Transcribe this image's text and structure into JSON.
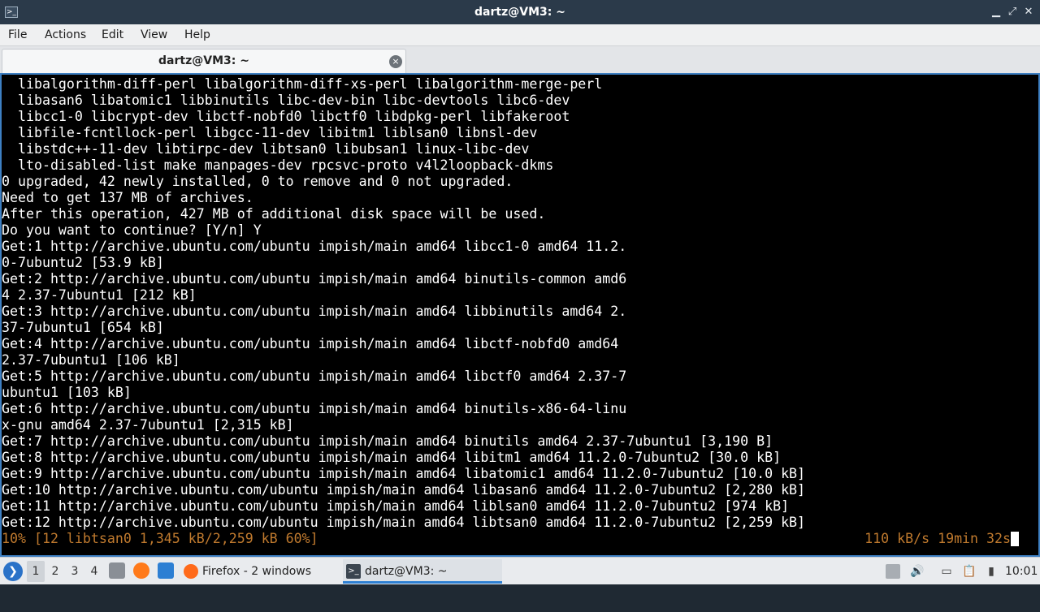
{
  "window": {
    "title": "dartz@VM3: ~",
    "min_glyph": "▁",
    "max_glyph": "⤢",
    "close_glyph": "✕",
    "app_icon_glyph": ">_"
  },
  "menu": {
    "file": "File",
    "actions": "Actions",
    "edit": "Edit",
    "view": "View",
    "help": "Help"
  },
  "tab": {
    "label": "dartz@VM3: ~",
    "close_glyph": "×"
  },
  "terminal": {
    "lines": [
      "  libalgorithm-diff-perl libalgorithm-diff-xs-perl libalgorithm-merge-perl",
      "  libasan6 libatomic1 libbinutils libc-dev-bin libc-devtools libc6-dev",
      "  libcc1-0 libcrypt-dev libctf-nobfd0 libctf0 libdpkg-perl libfakeroot",
      "  libfile-fcntllock-perl libgcc-11-dev libitm1 liblsan0 libnsl-dev",
      "  libstdc++-11-dev libtirpc-dev libtsan0 libubsan1 linux-libc-dev",
      "  lto-disabled-list make manpages-dev rpcsvc-proto v4l2loopback-dkms",
      "0 upgraded, 42 newly installed, 0 to remove and 0 not upgraded.",
      "Need to get 137 MB of archives.",
      "After this operation, 427 MB of additional disk space will be used.",
      "Do you want to continue? [Y/n] Y",
      "Get:1 http://archive.ubuntu.com/ubuntu impish/main amd64 libcc1-0 amd64 11.2.",
      "0-7ubuntu2 [53.9 kB]",
      "Get:2 http://archive.ubuntu.com/ubuntu impish/main amd64 binutils-common amd6",
      "4 2.37-7ubuntu1 [212 kB]",
      "Get:3 http://archive.ubuntu.com/ubuntu impish/main amd64 libbinutils amd64 2.",
      "37-7ubuntu1 [654 kB]",
      "Get:4 http://archive.ubuntu.com/ubuntu impish/main amd64 libctf-nobfd0 amd64",
      "2.37-7ubuntu1 [106 kB]",
      "Get:5 http://archive.ubuntu.com/ubuntu impish/main amd64 libctf0 amd64 2.37-7",
      "ubuntu1 [103 kB]",
      "Get:6 http://archive.ubuntu.com/ubuntu impish/main amd64 binutils-x86-64-linu",
      "x-gnu amd64 2.37-7ubuntu1 [2,315 kB]",
      "Get:7 http://archive.ubuntu.com/ubuntu impish/main amd64 binutils amd64 2.37-7ubuntu1 [3,190 B]",
      "Get:8 http://archive.ubuntu.com/ubuntu impish/main amd64 libitm1 amd64 11.2.0-7ubuntu2 [30.0 kB]",
      "Get:9 http://archive.ubuntu.com/ubuntu impish/main amd64 libatomic1 amd64 11.2.0-7ubuntu2 [10.0 kB]",
      "Get:10 http://archive.ubuntu.com/ubuntu impish/main amd64 libasan6 amd64 11.2.0-7ubuntu2 [2,280 kB]",
      "Get:11 http://archive.ubuntu.com/ubuntu impish/main amd64 liblsan0 amd64 11.2.0-7ubuntu2 [974 kB]",
      "Get:12 http://archive.ubuntu.com/ubuntu impish/main amd64 libtsan0 amd64 11.2.0-7ubuntu2 [2,259 kB]"
    ],
    "progress_left": "10% [12 libtsan0 1,345 kB/2,259 kB 60%]",
    "progress_right": "110 kB/s 19min 32s",
    "progress_color": "#c07a2e",
    "border_color": "#3d7fc2"
  },
  "taskbar": {
    "start_glyph": "❯",
    "workspaces": [
      "1",
      "2",
      "3",
      "4"
    ],
    "active_workspace": "1",
    "tasks": {
      "firefox": "Firefox - 2 windows",
      "terminal": "dartz@VM3: ~",
      "terminal_glyph": ">_"
    },
    "tray": {
      "volume_glyph": "🔊",
      "display_glyph": "▭",
      "clipboard_glyph": "📋",
      "power_glyph": "▮"
    },
    "clock": "10:01"
  }
}
